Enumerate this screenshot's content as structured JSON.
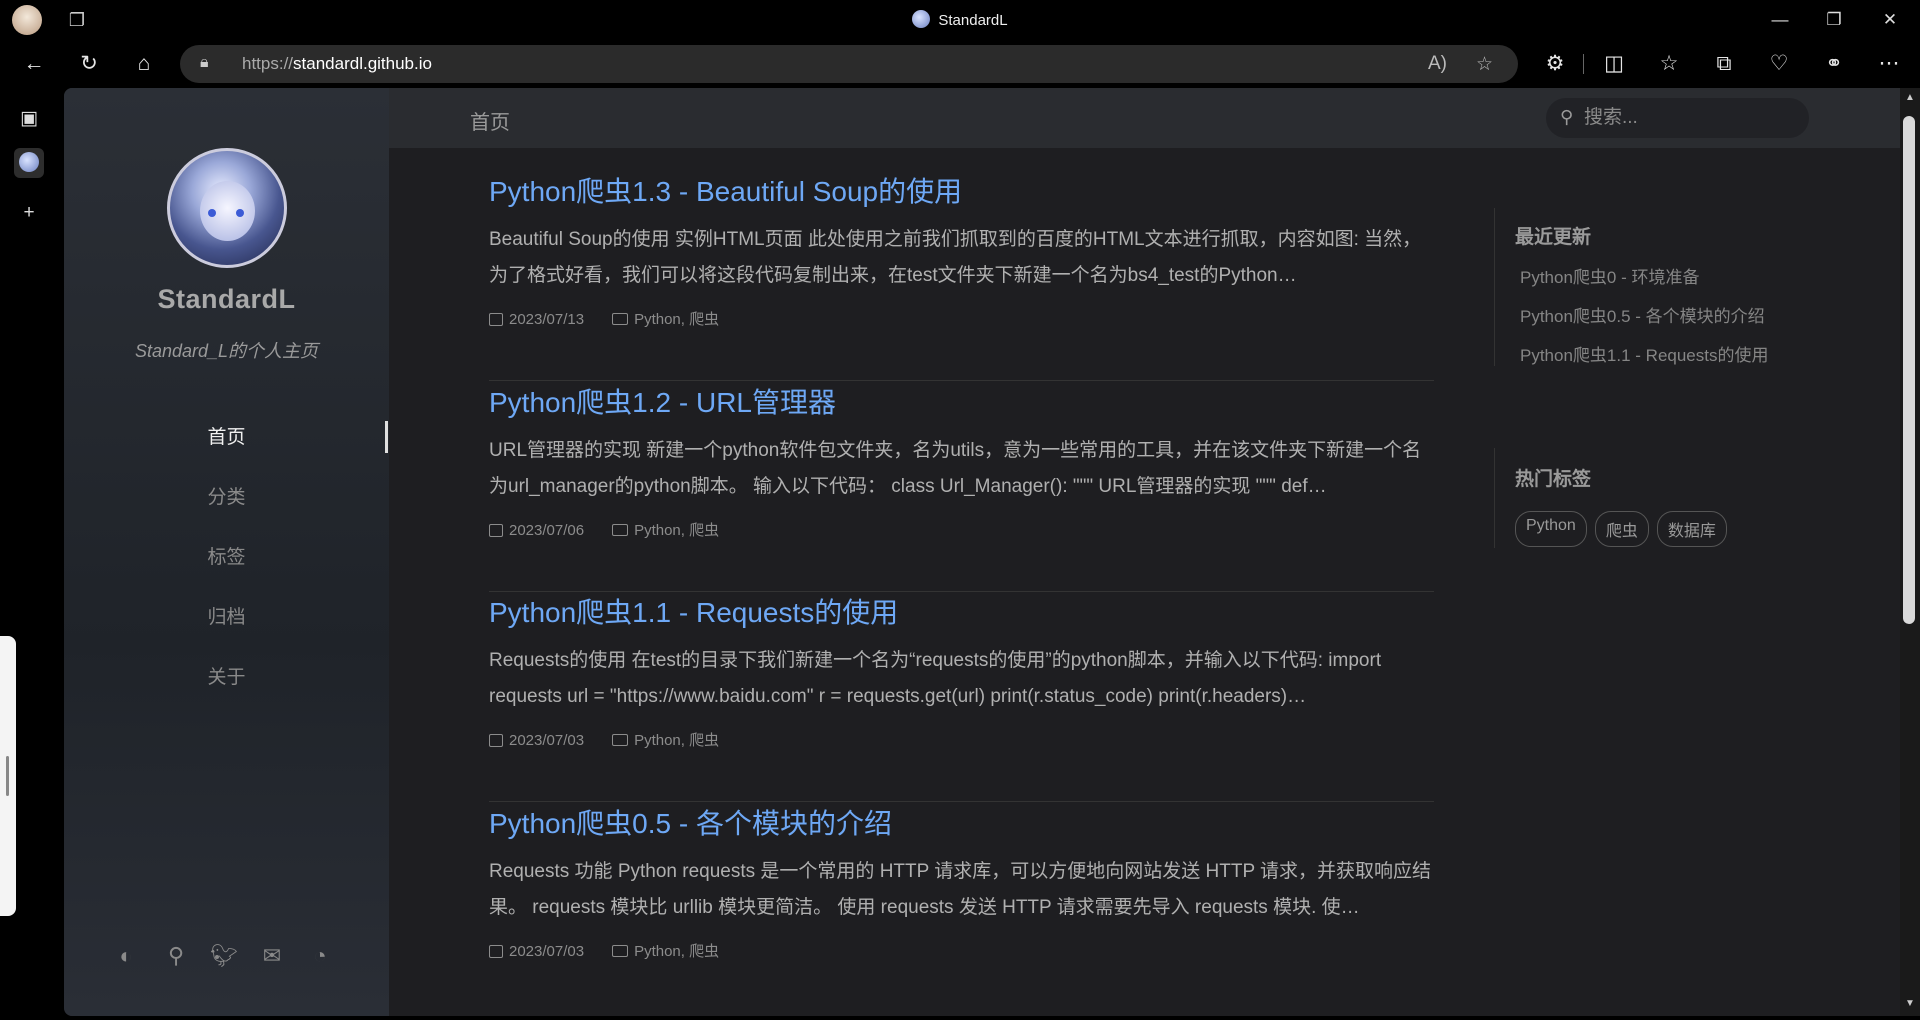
{
  "browser": {
    "title": "StandardL",
    "url_scheme": "https://",
    "url_host": "standardl.github.io"
  },
  "site": {
    "title": "StandardL",
    "subtitle": "Standard_L的个人主页"
  },
  "menu": [
    {
      "label": "首页",
      "active": true
    },
    {
      "label": "分类",
      "active": false
    },
    {
      "label": "标签",
      "active": false
    },
    {
      "label": "归档",
      "active": false
    },
    {
      "label": "关于",
      "active": false
    }
  ],
  "header": {
    "breadcrumb": "首页",
    "search_placeholder": "搜索..."
  },
  "posts": [
    {
      "title": "Python爬虫1.3 - Beautiful Soup的使用",
      "excerpt": "Beautiful Soup的使用 实例HTML页面 此处使用之前我们抓取到的百度的HTML文本进行抓取，内容如图: 当然，为了格式好看，我们可以将这段代码复制出来，在test文件夹下新建一个名为bs4_test的Python…",
      "date": "2023/07/13",
      "categories": "Python, 爬虫"
    },
    {
      "title": "Python爬虫1.2 - URL管理器",
      "excerpt": "URL管理器的实现 新建一个python软件包文件夹，名为utils，意为一些常用的工具，并在该文件夹下新建一个名为url_manager的python脚本。 输入以下代码： class Url_Manager(): \"\"\" URL管理器的实现 \"\"\" def…",
      "date": "2023/07/06",
      "categories": "Python, 爬虫"
    },
    {
      "title": "Python爬虫1.1 - Requests的使用",
      "excerpt": "Requests的使用 在test的目录下我们新建一个名为“requests的使用”的python脚本，并输入以下代码: import requests url = \"https://www.baidu.com\" r = requests.get(url) print(r.status_code) print(r.headers)…",
      "date": "2023/07/03",
      "categories": "Python, 爬虫"
    },
    {
      "title": "Python爬虫0.5 - 各个模块的介绍",
      "excerpt": "Requests 功能 Python requests 是一个常用的 HTTP 请求库，可以方便地向网站发送 HTTP 请求，并获取响应结果。 requests 模块比 urllib 模块更简洁。 使用 requests 发送 HTTP 请求需要先导入 requests 模块. 使…",
      "date": "2023/07/03",
      "categories": "Python, 爬虫"
    }
  ],
  "recent": {
    "title": "最近更新",
    "items": [
      "Python爬虫0 - 环境准备",
      "Python爬虫0.5 - 各个模块的介绍",
      "Python爬虫1.1 - Requests的使用"
    ]
  },
  "hot_tags": {
    "title": "热门标签",
    "items": [
      "Python",
      "爬虫",
      "数据库"
    ]
  },
  "colors": {
    "link": "#6ea8f5",
    "page_bg": "#1e1e21",
    "sidebar_bg": "#2b2f36"
  }
}
